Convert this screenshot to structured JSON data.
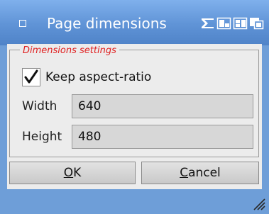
{
  "window": {
    "title": "Page dimensions",
    "accent": "#6e9ed8",
    "icons": [
      "close-icon",
      "minimize-icon",
      "restore-icon",
      "maximize-icon",
      "overlap-icon"
    ]
  },
  "group": {
    "legend": "Dimensions settings"
  },
  "aspect": {
    "label": "Keep aspect-ratio",
    "checked": true
  },
  "fields": {
    "width_label": "Width",
    "width_value": "640",
    "height_label": "Height",
    "height_value": "480"
  },
  "buttons": {
    "ok_mnemonic": "O",
    "ok_rest": "K",
    "cancel_mnemonic": "C",
    "cancel_rest": "ancel"
  }
}
